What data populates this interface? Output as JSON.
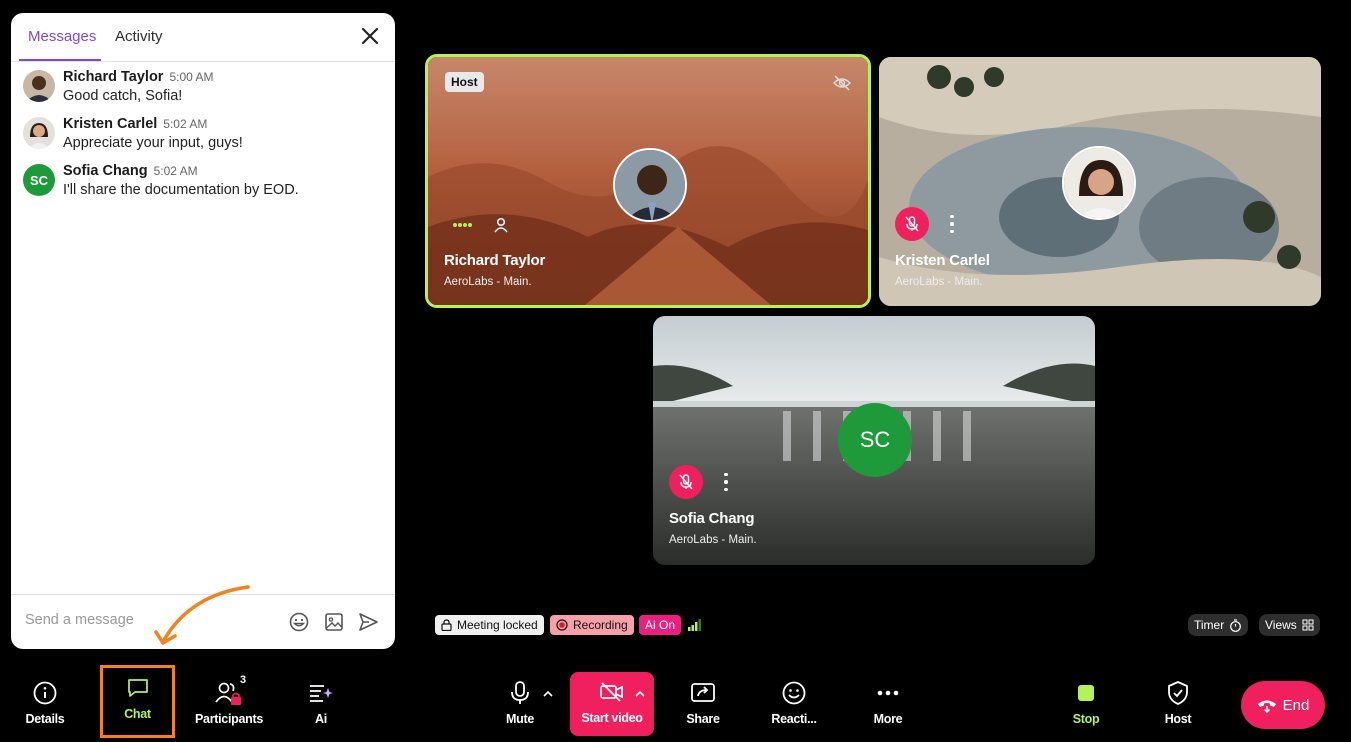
{
  "chat": {
    "tabs": [
      {
        "label": "Messages",
        "active": true
      },
      {
        "label": "Activity",
        "active": false
      }
    ],
    "messages": [
      {
        "name": "Richard Taylor",
        "time": "5:00 AM",
        "text": "Good catch, Sofia!"
      },
      {
        "name": "Kristen Carlel",
        "time": "5:02 AM",
        "text": "Appreciate your input, guys!"
      },
      {
        "name": "Sofia Chang",
        "time": "5:02 AM",
        "text": "I'll share the documentation by EOD.",
        "initials": "SC"
      }
    ],
    "input_placeholder": "Send a message"
  },
  "participants": [
    {
      "name": "Richard Taylor",
      "org": "AeroLabs - Main.",
      "badge": "Host",
      "active_speaker": true
    },
    {
      "name": "Kristen Carlel",
      "org": "AeroLabs - Main.",
      "muted": true
    },
    {
      "name": "Sofia Chang",
      "org": "AeroLabs - Main.",
      "muted": true,
      "initials": "SC"
    }
  ],
  "status": {
    "locked": "Meeting locked",
    "recording": "Recording",
    "ai": "Ai On",
    "timer": "Timer",
    "views": "Views"
  },
  "toolbar": {
    "details": "Details",
    "chat": "Chat",
    "participants": "Participants",
    "participants_count": "3",
    "ai": "Ai",
    "mute": "Mute",
    "start_video": "Start video",
    "share": "Share",
    "reactions": "Reacti...",
    "more": "More",
    "stop": "Stop",
    "host": "Host",
    "end": "End"
  },
  "colors": {
    "accent": "#7b48ef",
    "danger": "#f0205f",
    "speaker_border": "#b4f25a",
    "highlight": "#f4821f",
    "avatar_green": "#1f9a3b"
  }
}
